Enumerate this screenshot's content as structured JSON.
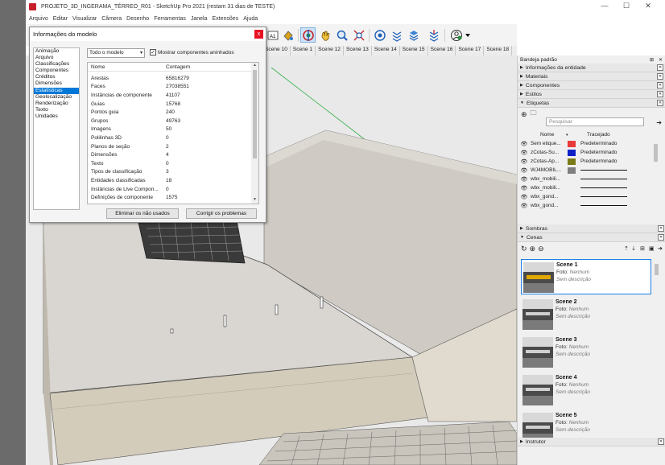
{
  "window": {
    "title": "PROJETO_3D_INGERAMA_TÉRREO_R01 - SketchUp Pro 2021 (restam 31 dias de TESTE)",
    "minimize": "—",
    "maximize": "☐",
    "close": "✕"
  },
  "menu": [
    "Arquivo",
    "Editar",
    "Visualizar",
    "Câmera",
    "Desenho",
    "Ferramentas",
    "Janela",
    "Extensões",
    "Ajuda"
  ],
  "scene_tabs": [
    "Scene 10",
    "Scene 1",
    "Scene 12",
    "Scene 13",
    "Scene 14",
    "Scene 15",
    "Scene 16",
    "Scene 17",
    "Scene 18"
  ],
  "dialog": {
    "title": "Informações do modelo",
    "close": "x",
    "categories": [
      "Animação",
      "Arquivo",
      "Classificações",
      "Componentes",
      "Créditos",
      "Dimensões",
      "Estatísticas",
      "Geolocalização",
      "Renderização",
      "Texto",
      "Unidades"
    ],
    "selected_category": "Estatísticas",
    "scope": "Todo o modelo",
    "nested_label": "Mostrar componentes aninhados",
    "nested_checked": true,
    "col_name": "Nome",
    "col_count": "Contagem",
    "stats": [
      {
        "name": "Arestas",
        "count": "65816279"
      },
      {
        "name": "Faces",
        "count": "27038551"
      },
      {
        "name": "Instâncias de componente",
        "count": "41107"
      },
      {
        "name": "Guias",
        "count": "15768"
      },
      {
        "name": "Pontos guia",
        "count": "240"
      },
      {
        "name": "Grupos",
        "count": "49763"
      },
      {
        "name": "Imagens",
        "count": "50"
      },
      {
        "name": "Polilinhas 3D",
        "count": "0"
      },
      {
        "name": "Planos de seção",
        "count": "2"
      },
      {
        "name": "Dimensões",
        "count": "4"
      },
      {
        "name": "Texto",
        "count": "0"
      },
      {
        "name": "Tipos de classificação",
        "count": "3"
      },
      {
        "name": "Entidades classificadas",
        "count": "18"
      },
      {
        "name": "Instâncias de Live Compon...",
        "count": "0"
      },
      {
        "name": "Definições de componente",
        "count": "1575"
      }
    ],
    "purge_button": "Eliminar os não usados",
    "fix_button": "Corrigir os problemas"
  },
  "tray": {
    "title": "Bandeja padrão",
    "sections_top": [
      "Informações da entidade",
      "Materiais",
      "Componentes",
      "Estilos"
    ],
    "tags_section": "Etiquetas",
    "search_placeholder": "Pesquisar",
    "tag_col_name": "Nome",
    "tag_col_dash": "Tracejado",
    "tags": [
      {
        "name": "Sem etique...",
        "color": "#e8393b",
        "dash": "Predeterminado"
      },
      {
        "name": "zCotas-Su...",
        "color": "#1020c8",
        "dash": "Predeterminado"
      },
      {
        "name": "zCotas-Ap...",
        "color": "#7a7a18",
        "dash": "Predeterminado"
      },
      {
        "name": "WJ4MOBIL...",
        "color": "#7f7f7f",
        "dash": ""
      },
      {
        "name": "wbx_mobili...",
        "color": "",
        "dash": ""
      },
      {
        "name": "wbx_mobili...",
        "color": "",
        "dash": ""
      },
      {
        "name": "wbx_gond...",
        "color": "",
        "dash": ""
      },
      {
        "name": "wbx_gond...",
        "color": "",
        "dash": ""
      }
    ],
    "sections_mid": [
      "Sombras",
      "Cenas"
    ],
    "scenes": [
      {
        "name": "Scene 1",
        "photo_label": "Foto:",
        "photo": "Nenhum",
        "desc": "Sem descrição"
      },
      {
        "name": "Scene 2",
        "photo_label": "Foto:",
        "photo": "Nenhum",
        "desc": "Sem descrição"
      },
      {
        "name": "Scene 3",
        "photo_label": "Foto:",
        "photo": "Nenhum",
        "desc": "Sem descrição"
      },
      {
        "name": "Scene 4",
        "photo_label": "Foto:",
        "photo": "Nenhum",
        "desc": "Sem descrição"
      },
      {
        "name": "Scene 5",
        "photo_label": "Foto:",
        "photo": "Nenhum",
        "desc": "Sem descrição"
      }
    ],
    "instructor": "Instrutor"
  },
  "colors": {
    "accent": "#0078d7",
    "scene_selected": "#1e7ee4",
    "close_red": "#e81123"
  }
}
